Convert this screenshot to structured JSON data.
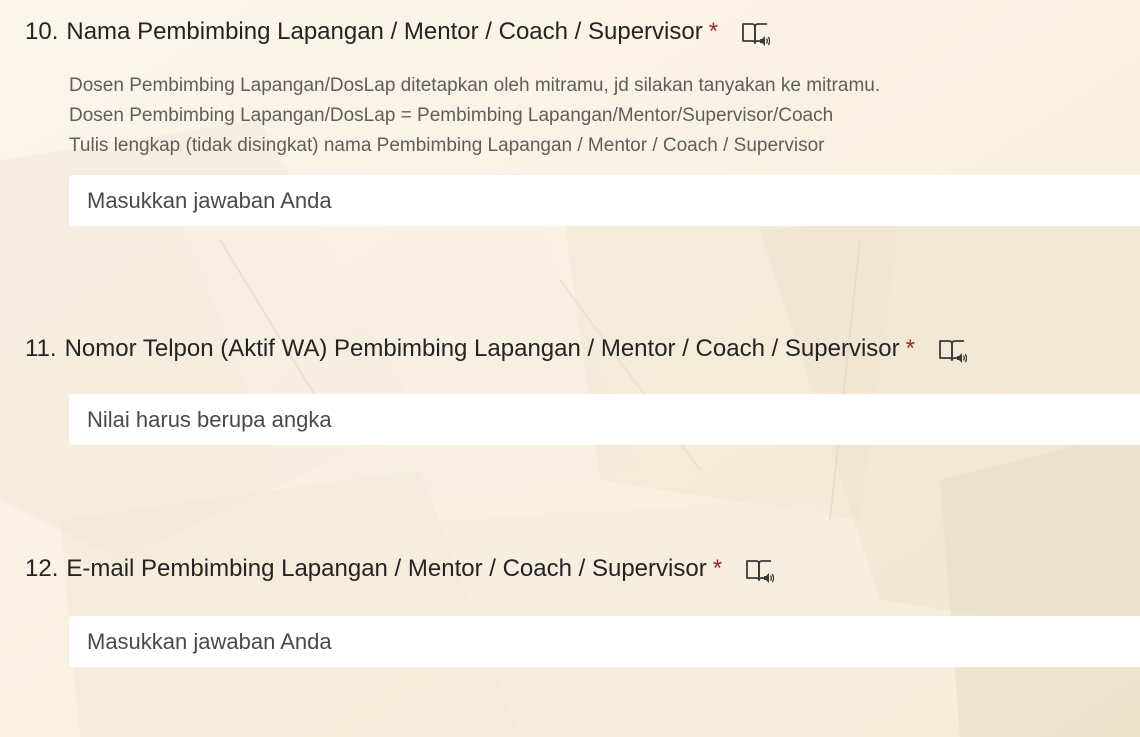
{
  "questions": [
    {
      "number": "10.",
      "title": "Nama Pembimbing Lapangan / Mentor / Coach / Supervisor",
      "required": "*",
      "subtitle_lines": [
        "Dosen Pembimbing Lapangan/DosLap ditetapkan oleh mitramu, jd silakan tanyakan ke mitramu.",
        "Dosen Pembimbing Lapangan/DosLap = Pembimbing Lapangan/Mentor/Supervisor/Coach",
        "Tulis lengkap (tidak disingkat) nama Pembimbing Lapangan / Mentor / Coach / Supervisor"
      ],
      "placeholder": "Masukkan jawaban Anda",
      "reader_icon": "immersive-reader-icon"
    },
    {
      "number": "11.",
      "title": "Nomor Telpon (Aktif WA) Pembimbing Lapangan / Mentor / Coach / Supervisor",
      "required": "*",
      "placeholder": "Nilai harus berupa angka",
      "reader_icon": "immersive-reader-icon"
    },
    {
      "number": "12.",
      "title": "E-mail Pembimbing Lapangan / Mentor / Coach / Supervisor",
      "required": "*",
      "placeholder": "Masukkan jawaban Anda",
      "reader_icon": "immersive-reader-icon"
    }
  ],
  "colors": {
    "required": "#a4262c",
    "subtitle": "#605e5c",
    "text": "#242424",
    "background": "#f8f1e4"
  }
}
